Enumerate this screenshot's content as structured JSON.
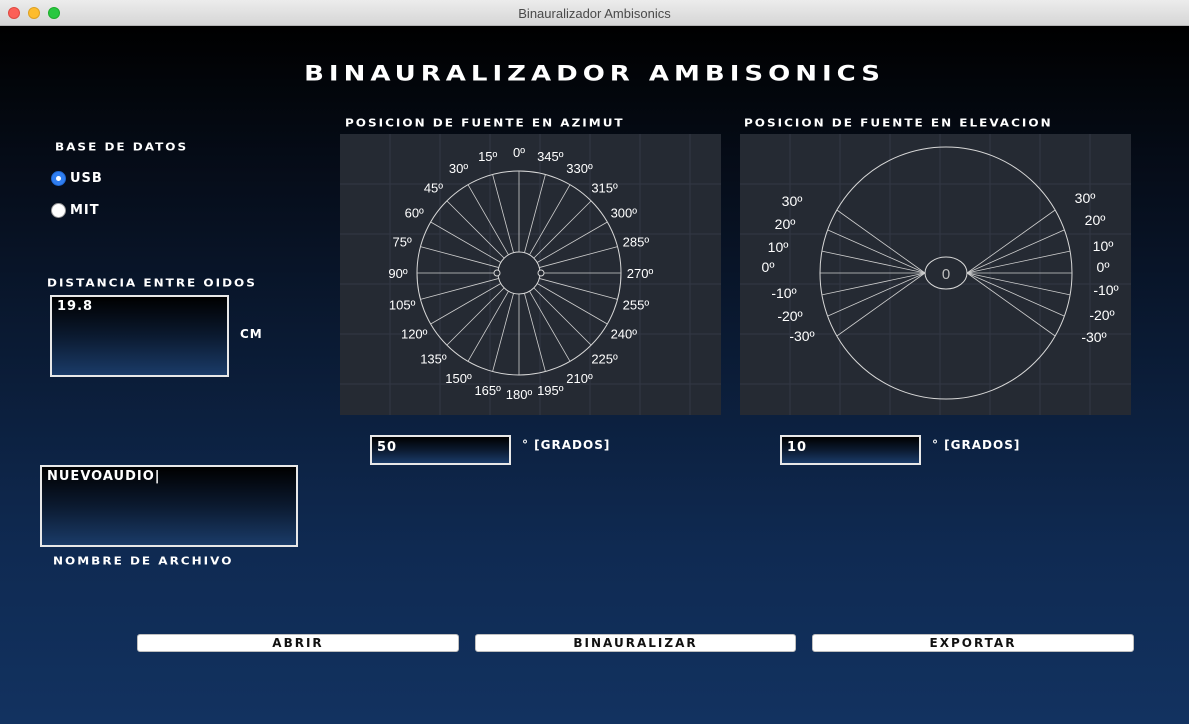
{
  "window": {
    "title": "Binauralizador Ambisonics"
  },
  "app": {
    "title": "BINAURALIZADOR AMBISONICS"
  },
  "database": {
    "label": "BASE DE DATOS",
    "options": [
      {
        "label": "USB",
        "selected": true
      },
      {
        "label": "MIT",
        "selected": false
      }
    ]
  },
  "ear_distance": {
    "label": "DISTANCIA ENTRE OIDOS",
    "value": "19.8",
    "unit": "CM"
  },
  "file": {
    "value": "NUEVOAUDIO|",
    "label": "NOMBRE DE ARCHIVO"
  },
  "azimuth": {
    "label": "POSICION DE FUENTE EN AZIMUT",
    "value": "50",
    "unit": "° [GRADOS]",
    "angle_labels": [
      "0º",
      "15º",
      "30º",
      "45º",
      "60º",
      "75º",
      "90º",
      "105º",
      "120º",
      "135º",
      "150º",
      "165º",
      "180º",
      "195º",
      "210º",
      "225º",
      "240º",
      "255º",
      "270º",
      "285º",
      "300º",
      "315º",
      "330º",
      "345º"
    ]
  },
  "elevation": {
    "label": "POSICION DE FUENTE EN ELEVACION",
    "value": "10",
    "unit": "° [GRADOS]",
    "center_label": "0",
    "left_labels": [
      "30º",
      "20º",
      "10º",
      "0º",
      "-10º",
      "-20º",
      "-30º"
    ],
    "right_labels": [
      "30º",
      "20º",
      "10º",
      "0º",
      "-10º",
      "-20º",
      "-30º"
    ]
  },
  "buttons": {
    "open": "ABRIR",
    "binauralize": "BINAURALIZAR",
    "export": "EXPORTAR"
  }
}
